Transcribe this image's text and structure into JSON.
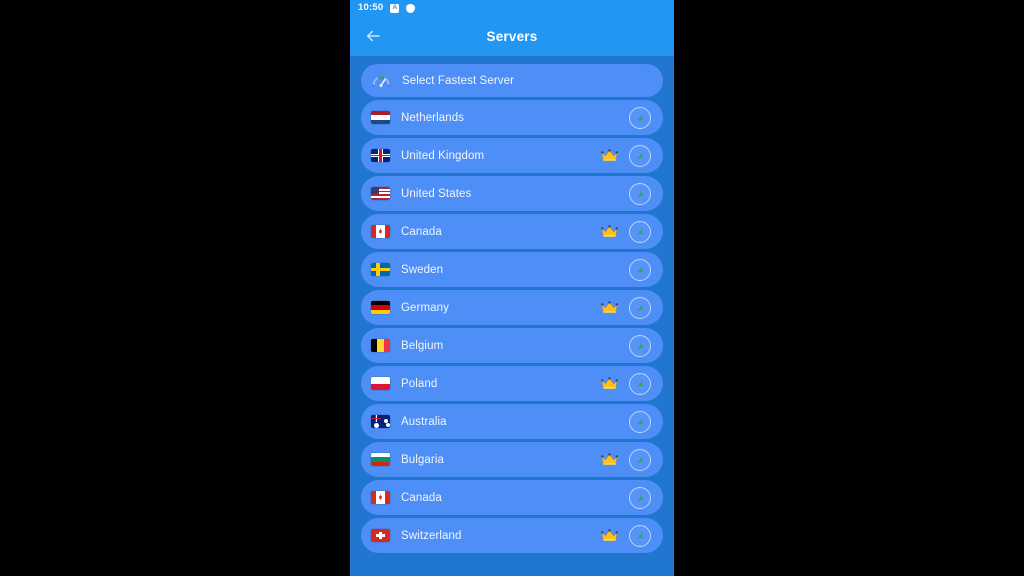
{
  "status_bar": {
    "time": "10:50",
    "icons": [
      {
        "name": "app-notification-icon",
        "glyph": "A"
      },
      {
        "name": "vpn-shield-icon",
        "glyph": ""
      }
    ]
  },
  "header": {
    "back_icon": "arrow-left-icon",
    "title": "Servers"
  },
  "fastest_row": {
    "icon": "speedometer-icon",
    "label": "Select Fastest Server"
  },
  "colors": {
    "status_bar": "#2196f3",
    "header": "#2196f3",
    "page_background": "#2176cf",
    "row_background": "#4d8ef7",
    "row_text": "#f2f6ff",
    "crown": "#ffc21f",
    "signal_ring": "#bcd6fb",
    "signal_fill": "#2fa84f",
    "outer_background": "#000000"
  },
  "server_list": [
    {
      "country": "Netherlands",
      "flag": "nl",
      "premium": false
    },
    {
      "country": "United Kingdom",
      "flag": "gb",
      "premium": true
    },
    {
      "country": "United States",
      "flag": "us",
      "premium": false
    },
    {
      "country": "Canada",
      "flag": "ca",
      "premium": true
    },
    {
      "country": "Sweden",
      "flag": "se",
      "premium": false
    },
    {
      "country": "Germany",
      "flag": "de",
      "premium": true
    },
    {
      "country": "Belgium",
      "flag": "be",
      "premium": false
    },
    {
      "country": "Poland",
      "flag": "pl",
      "premium": true
    },
    {
      "country": "Australia",
      "flag": "au",
      "premium": false
    },
    {
      "country": "Bulgaria",
      "flag": "bg",
      "premium": true
    },
    {
      "country": "Canada",
      "flag": "ca",
      "premium": false
    },
    {
      "country": "Switzerland",
      "flag": "ch",
      "premium": true
    }
  ]
}
